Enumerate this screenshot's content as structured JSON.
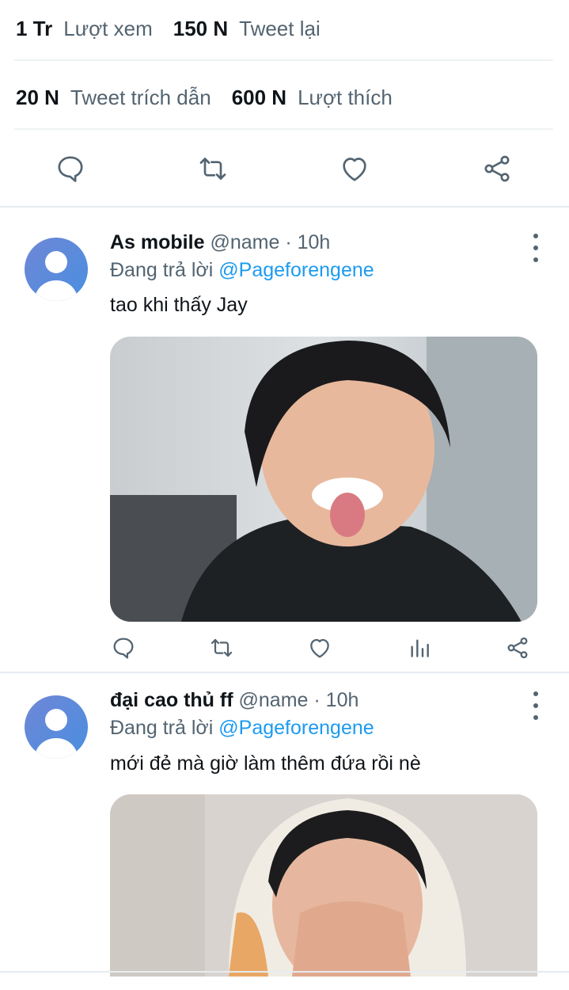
{
  "stats": {
    "views_count": "1 Tr",
    "views_label": "Lượt xem",
    "retweets_count": "150 N",
    "retweets_label": "Tweet lại",
    "quotes_count": "20 N",
    "quotes_label": "Tweet trích dẫn",
    "likes_count": "600 N",
    "likes_label": "Lượt thích"
  },
  "colors": {
    "accent": "#1d9bf0",
    "text_primary": "#0f1419",
    "text_secondary": "#536471",
    "divider": "#eff3f4"
  },
  "icons": {
    "reply": "reply-icon",
    "retweet": "retweet-icon",
    "like": "heart-icon",
    "share": "share-icon",
    "analytics": "analytics-icon",
    "more": "more-vertical-icon"
  },
  "replies": [
    {
      "display_name": "As mobile",
      "handle": "@name",
      "separator": "·",
      "time": "10h",
      "replying_to_prefix": "Đang trả lời",
      "replying_to_handle": "@Pageforengene",
      "text": "tao khi thấy Jay"
    },
    {
      "display_name": "đại cao thủ ff",
      "handle": "@name",
      "separator": "·",
      "time": "10h",
      "replying_to_prefix": "Đang trả lời",
      "replying_to_handle": "@Pageforengene",
      "text": "mới đẻ mà giờ làm thêm đứa rồi nè"
    }
  ]
}
